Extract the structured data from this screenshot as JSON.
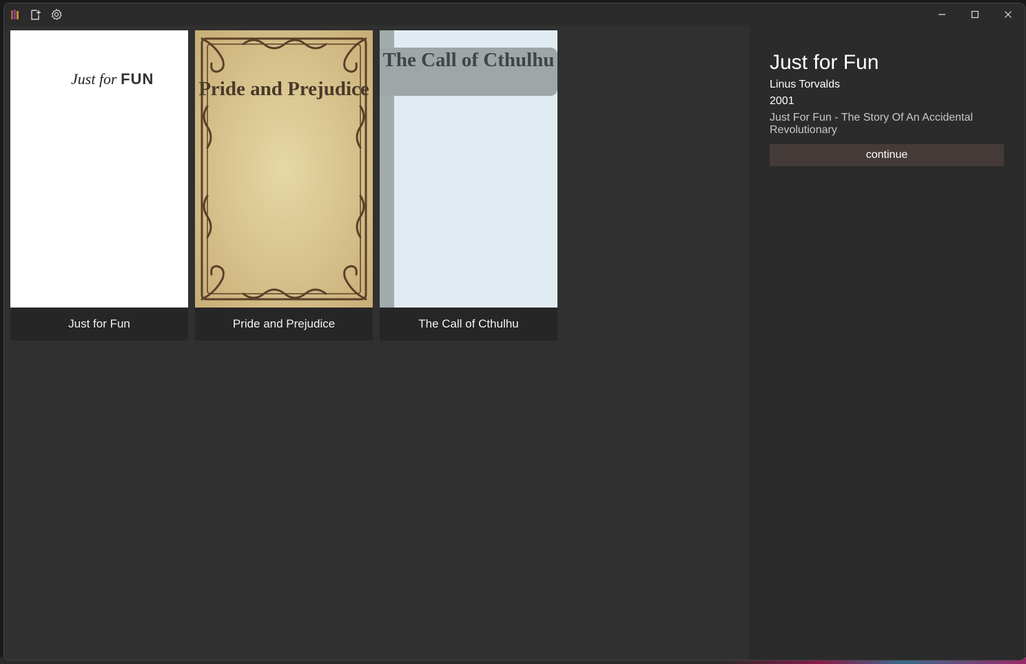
{
  "titlebar": {
    "icons": [
      "app-books-icon",
      "import-icon",
      "settings-icon"
    ],
    "window_controls": [
      "minimize-icon",
      "maximize-icon",
      "close-icon"
    ]
  },
  "library": {
    "books": [
      {
        "title": "Just for Fun",
        "cover_text": "Just for",
        "cover_text_bold": "FUN"
      },
      {
        "title": "Pride and Prejudice",
        "cover_text": "Pride and Prejudice"
      },
      {
        "title": "The Call of Cthulhu",
        "cover_text": "The Call of Cthulhu"
      }
    ]
  },
  "detail": {
    "title": "Just for Fun",
    "author": "Linus Torvalds",
    "year": "2001",
    "subtitle": "Just For Fun - The Story Of An Accidental Revolutionary",
    "continue_label": "continue"
  },
  "colors": {
    "content_bg": "#303030",
    "panel_bg": "#2b2b2b",
    "button_bg": "#443b38"
  }
}
